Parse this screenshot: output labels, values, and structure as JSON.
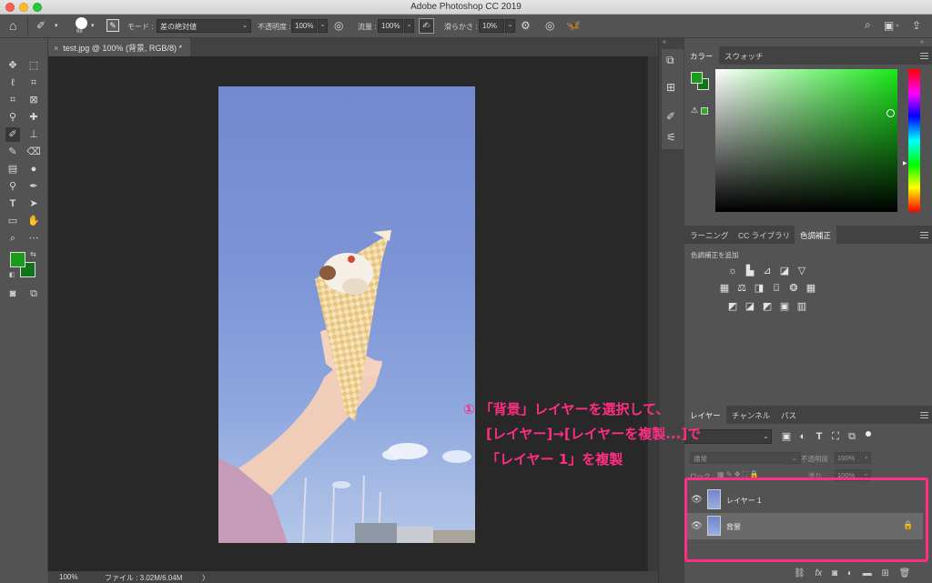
{
  "window": {
    "title": "Adobe Photoshop CC 2019"
  },
  "options_bar": {
    "brush_size": "68",
    "mode_label": "モード :",
    "mode_value": "差の絶対値",
    "opacity_label": "不透明度 :",
    "opacity_value": "100%",
    "flow_label": "流量 :",
    "flow_value": "100%",
    "smoothing_label": "滑らかさ :",
    "smoothing_value": "10%"
  },
  "document_tab": {
    "label": "test.jpg @ 100% (背景, RGB/8) *",
    "close": "×"
  },
  "status_bar": {
    "zoom": "100%",
    "file_info": "ファイル : 3.02M/6.04M",
    "arrow": "〉"
  },
  "colors": {
    "foreground": "#1a9c1a",
    "background": "#12741a",
    "accent": "#ff2d84"
  },
  "color_panel": {
    "tabs": [
      "カラー",
      "スウォッチ"
    ],
    "active_tab": 0
  },
  "adjust_panel": {
    "tabs": [
      "ラーニング",
      "CC ライブラリ",
      "色調補正"
    ],
    "active_tab": 2,
    "heading": "色調補正を追加"
  },
  "layers_panel": {
    "tabs": [
      "レイヤー",
      "チャンネル",
      "パス"
    ],
    "active_tab": 0,
    "blend_mode": "通常",
    "opacity_label": "不透明度 :",
    "opacity_value": "100%",
    "lock_label": "ロック :",
    "fill_label": "塗り :",
    "fill_value": "100%",
    "layers": [
      {
        "name": "レイヤー 1",
        "selected": false,
        "locked": false
      },
      {
        "name": "背景",
        "selected": true,
        "locked": true
      }
    ]
  },
  "annotation": {
    "line1": "① 「背景」レイヤーを選択して、",
    "line2": "[レイヤー]→[レイヤーを複製...]で",
    "line3": "「レイヤー 1」を複製"
  }
}
